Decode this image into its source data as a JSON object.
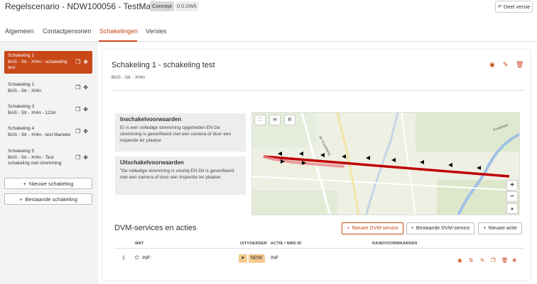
{
  "header": {
    "title": "Regelscenario - NDW100056 - TestMark123",
    "status_badge": "Concept",
    "version_badge": "0.0.0W6",
    "share_button": "Deel versie"
  },
  "tabs": [
    {
      "label": "Algemeen"
    },
    {
      "label": "Contactpersonen"
    },
    {
      "label": "Schakelingen"
    },
    {
      "label": "Versies"
    }
  ],
  "sidebar": {
    "items": [
      {
        "title": "Schakeling 1",
        "subtitle": "BAS - Str - XHin - schakeling test"
      },
      {
        "title": "Schakeling 2",
        "subtitle": "BAS - Str - XHin"
      },
      {
        "title": "Schakeling 3",
        "subtitle": "BAS - Str - XHin - 1234"
      },
      {
        "title": "Schakeling 4",
        "subtitle": "BAS - Str - XHin - test Marieke"
      },
      {
        "title": "Schakeling 5",
        "subtitle": "BAS - Str - XHin - Test schakeling met stremming"
      }
    ],
    "new_button": "Nieuwe schakeling",
    "existing_button": "Bestaande schakeling"
  },
  "detail": {
    "title": "Schakeling 1 - schakeling test",
    "subtitle": "BAS - Str - XHin",
    "inschakel_title": "Inschakelvoorwaarden",
    "inschakel_text": "Er is een volledige stremming opgetreden EN De stremming is geverifieerd met een camera of door een inspectie ter plaatse",
    "uitschakel_title": "Uitschakelvoorwaarden",
    "uitschakel_text": "\"De volledige stremming is voorbij EN Dit is geverifieerd met een camera of door een inspectie ter plaatse"
  },
  "map": {
    "btn_h": "H",
    "btn_r": "R",
    "zoom_in": "+",
    "zoom_out": "−",
    "compass": "▲",
    "street_label_1": "de Vrachtweg",
    "street_label_2": "Kruisbaan"
  },
  "dvm": {
    "title": "DVM-services en acties",
    "new_dvm_button": "Nieuwe DVM-service",
    "existing_dvm_button": "Bestaande DVM-service",
    "new_action_button": "Nieuwe actie",
    "columns": {
      "wat": "WAT",
      "uitvoerder": "UITVOERDER",
      "actie": "ACTIE / NMS-ID",
      "rand": "RANDVOORWAARDEN"
    },
    "rows": [
      {
        "nr": "1",
        "wat": "INF:",
        "uitvoerder": "NDW",
        "actie": "INF"
      }
    ]
  },
  "colors": {
    "accent": "#c84818",
    "route": "#c00000"
  }
}
